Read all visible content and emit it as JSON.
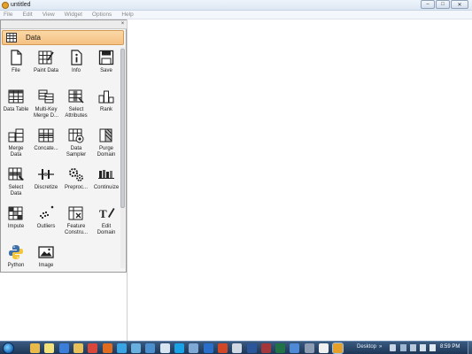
{
  "window": {
    "title": "untitled",
    "controls": [
      "minimize",
      "maximize",
      "close"
    ]
  },
  "menu": [
    "File",
    "Edit",
    "View",
    "Widget",
    "Options",
    "Help"
  ],
  "panel": {
    "category": "Data",
    "close_glyph": "×",
    "widgets": [
      {
        "label": "File",
        "icon": "file-icon"
      },
      {
        "label": "Paint Data",
        "icon": "paint-data-icon"
      },
      {
        "label": "Info",
        "icon": "info-icon"
      },
      {
        "label": "Save",
        "icon": "save-icon"
      },
      {
        "label": "Data Table",
        "icon": "data-table-icon"
      },
      {
        "label": "Multi-Key\nMerge D...",
        "icon": "multi-key-merge-icon"
      },
      {
        "label": "Select\nAttributes",
        "icon": "select-attributes-icon"
      },
      {
        "label": "Rank",
        "icon": "rank-icon"
      },
      {
        "label": "Merge\nData",
        "icon": "merge-data-icon"
      },
      {
        "label": "Concate...",
        "icon": "concatenate-icon"
      },
      {
        "label": "Data\nSampler",
        "icon": "data-sampler-icon"
      },
      {
        "label": "Purge\nDomain",
        "icon": "purge-domain-icon"
      },
      {
        "label": "Select\nData",
        "icon": "select-data-icon"
      },
      {
        "label": "Discretize",
        "icon": "discretize-icon"
      },
      {
        "label": "Preproc...",
        "icon": "preprocess-icon"
      },
      {
        "label": "Continuize",
        "icon": "continuize-icon"
      },
      {
        "label": "Impute",
        "icon": "impute-icon"
      },
      {
        "label": "Outliers",
        "icon": "outliers-icon"
      },
      {
        "label": "Feature\nConstru...",
        "icon": "feature-constructor-icon"
      },
      {
        "label": "Edit\nDomain",
        "icon": "edit-domain-icon"
      },
      {
        "label": "Python",
        "icon": "python-icon"
      },
      {
        "label": "Image",
        "icon": "image-icon"
      }
    ]
  },
  "taskbar": {
    "desktop_label": "Desktop",
    "chevron": "»",
    "clock": "8:59 PM",
    "apps": [
      {
        "name": "explorer-icon",
        "color": "#e9b949",
        "active": false
      },
      {
        "name": "sticky-notes-icon",
        "color": "#f3e27a",
        "active": false
      },
      {
        "name": "media-player-icon",
        "color": "#3b7dd8",
        "active": false
      },
      {
        "name": "folder-icon",
        "color": "#e8c05a",
        "active": false
      },
      {
        "name": "chrome-icon",
        "color": "#d9473b",
        "active": false
      },
      {
        "name": "firefox-icon",
        "color": "#e06d1f",
        "active": false
      },
      {
        "name": "ie-icon",
        "color": "#3aa3e3",
        "active": false
      },
      {
        "name": "app-icon",
        "color": "#6ab0de",
        "active": false
      },
      {
        "name": "monitor-icon",
        "color": "#4c8fcf",
        "active": false
      },
      {
        "name": "notepad-icon",
        "color": "#d7e4f2",
        "active": false
      },
      {
        "name": "skype-icon",
        "color": "#19a3e6",
        "active": false
      },
      {
        "name": "remote-icon",
        "color": "#7fa9d4",
        "active": false
      },
      {
        "name": "outlook-icon",
        "color": "#2a6fc9",
        "active": false
      },
      {
        "name": "powerpoint-icon",
        "color": "#d24726",
        "active": false
      },
      {
        "name": "window-icon",
        "color": "#cfd8e3",
        "active": false
      },
      {
        "name": "word-icon",
        "color": "#2b579a",
        "active": false
      },
      {
        "name": "access-icon",
        "color": "#a4373a",
        "active": false
      },
      {
        "name": "excel-icon",
        "color": "#217346",
        "active": false
      },
      {
        "name": "app2-icon",
        "color": "#4e8ad6",
        "active": false
      },
      {
        "name": "app3-icon",
        "color": "#8c9db3",
        "active": false
      },
      {
        "name": "app4-icon",
        "color": "#f0f0f0",
        "active": false
      },
      {
        "name": "orange-icon",
        "color": "#e4a02a",
        "active": true
      }
    ]
  }
}
